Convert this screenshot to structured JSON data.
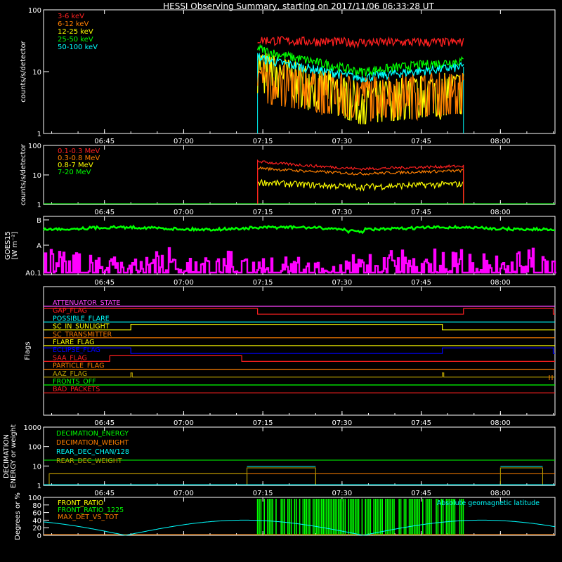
{
  "title": "HESSI Observing Summary, starting on 2017/11/06 06:33:28 UT",
  "time_ticks": [
    "06:45",
    "07:00",
    "07:15",
    "07:30",
    "07:45",
    "08:00"
  ],
  "colors": {
    "red": "#ff2020",
    "orange": "#ff7f00",
    "yellow": "#ffff00",
    "green": "#00ff00",
    "cyan": "#00ffff",
    "magenta": "#ff00ff",
    "blue": "#0000ff",
    "pink": "#ff44ff",
    "olive": "#b8a000",
    "salmon": "#ff6030"
  },
  "chart_data": [
    {
      "id": "hxr",
      "type": "line",
      "ylabel": "counts/s/detector",
      "yscale": "log",
      "ylim": [
        1,
        100
      ],
      "ytick_labels": [
        "1",
        "10",
        "100"
      ],
      "observing_window": [
        "07:14",
        "07:53"
      ],
      "series": [
        {
          "name": "3-6 keV",
          "color": "#ff2020",
          "level": [
            "33",
            "30",
            "30"
          ]
        },
        {
          "name": "6-12 keV",
          "color": "#ff7f00",
          "level": [
            "10",
            "5",
            "6"
          ]
        },
        {
          "name": "12-25 keV",
          "color": "#ffff00",
          "level": [
            "15",
            "4",
            "6"
          ]
        },
        {
          "name": "25-50 keV",
          "color": "#00ff00",
          "level": [
            "25",
            "10",
            "15"
          ]
        },
        {
          "name": "50-100 keV",
          "color": "#00ffff",
          "level": [
            "18",
            "8",
            "12"
          ]
        }
      ]
    },
    {
      "id": "gamma",
      "type": "line",
      "ylabel": "counts/s/detector",
      "yscale": "log",
      "ylim": [
        1,
        100
      ],
      "ytick_labels": [
        "1",
        "10",
        "100"
      ],
      "observing_window": [
        "07:14",
        "07:53"
      ],
      "series": [
        {
          "name": "0.1-0.3 MeV",
          "color": "#ff2020",
          "level": [
            "30",
            "16",
            "20"
          ]
        },
        {
          "name": "0.3-0.8 MeV",
          "color": "#ff7f00",
          "level": [
            "18",
            "11",
            "14"
          ]
        },
        {
          "name": "0.8-7 MeV",
          "color": "#ffff00",
          "level": [
            "6",
            "4",
            "5"
          ]
        },
        {
          "name": "7-20 MeV",
          "color": "#00ff00",
          "level": [
            "1",
            "1",
            "1"
          ]
        }
      ]
    },
    {
      "id": "goes",
      "type": "line",
      "ylabel": "GOES15",
      "ylabel2": "[W m⁻²]",
      "ytick_labels": [
        "A0.1",
        "A",
        "B"
      ],
      "series": [
        {
          "name": "GOES long",
          "color": "#00ff00",
          "level": "B-"
        },
        {
          "name": "GOES short",
          "color": "#ff00ff",
          "level": "A0.1-A0.5"
        }
      ]
    },
    {
      "id": "flags",
      "type": "table",
      "ylabel": "Flags",
      "flags": [
        {
          "name": "ATTENUATOR_STATE",
          "color": "#ff44ff"
        },
        {
          "name": "GAP_FLAG",
          "color": "#ff2020",
          "high": [
            [
              "06:33",
              "07:14"
            ],
            [
              "07:53",
              "08:10"
            ]
          ]
        },
        {
          "name": "POSSIBLE_FLARE",
          "color": "#00ffff"
        },
        {
          "name": "SC_IN_SUNLIGHT",
          "color": "#ffff00",
          "high": [
            [
              "06:50",
              "07:49"
            ]
          ]
        },
        {
          "name": "SC_TRANSMITTER",
          "color": "#ff7f00"
        },
        {
          "name": "FLARE_FLAG",
          "color": "#ffff00"
        },
        {
          "name": "ECLIPSE_FLAG",
          "color": "#0000ff",
          "high": [
            [
              "06:33",
              "06:50"
            ],
            [
              "07:49",
              "08:10"
            ]
          ]
        },
        {
          "name": "SAA_FLAG",
          "color": "#ff2020",
          "high": [
            [
              "06:46",
              "07:11"
            ]
          ]
        },
        {
          "name": "PARTICLE_FLAG",
          "color": "#ff7f00"
        },
        {
          "name": "AAZ_FLAG",
          "color": "#b8a000",
          "spikes": [
            "06:50",
            "07:49"
          ]
        },
        {
          "name": "FRONTS_OFF",
          "color": "#00ff00"
        },
        {
          "name": "BAD_PACKETS",
          "color": "#ff2020"
        }
      ]
    },
    {
      "id": "decimation",
      "type": "line",
      "ylabel": "DECIMATION",
      "ylabel2": "ENERGY or weight",
      "yscale": "log",
      "ylim": [
        1,
        1000
      ],
      "ytick_labels": [
        "1",
        "10",
        "100",
        "1000"
      ],
      "series": [
        {
          "name": "DECIMATION_ENERGY",
          "color": "#00ff00",
          "level": "20"
        },
        {
          "name": "DECIMATION_WEIGHT",
          "color": "#ff7f00",
          "level": "4"
        },
        {
          "name": "REAR_DEC_CHAN/128",
          "color": "#00ffff",
          "level": "1"
        },
        {
          "name": "REAR_DEC_WEIGHT",
          "color": "#b8a000",
          "level": "1-8"
        }
      ]
    },
    {
      "id": "ratios",
      "type": "line",
      "ylabel": "Degrees or %",
      "ylim": [
        0,
        100
      ],
      "ytick_labels": [
        "0",
        "20",
        "40",
        "60",
        "80",
        "100"
      ],
      "annotation": "Absolute geomagnetic latitude",
      "series": [
        {
          "name": "FRONT_RATIO",
          "color": "#ffff00"
        },
        {
          "name": "FRONT_RATIO_1225",
          "color": "#00ff00"
        },
        {
          "name": "MAX_DET_VS_TOT",
          "color": "#ff7f00"
        }
      ]
    }
  ]
}
